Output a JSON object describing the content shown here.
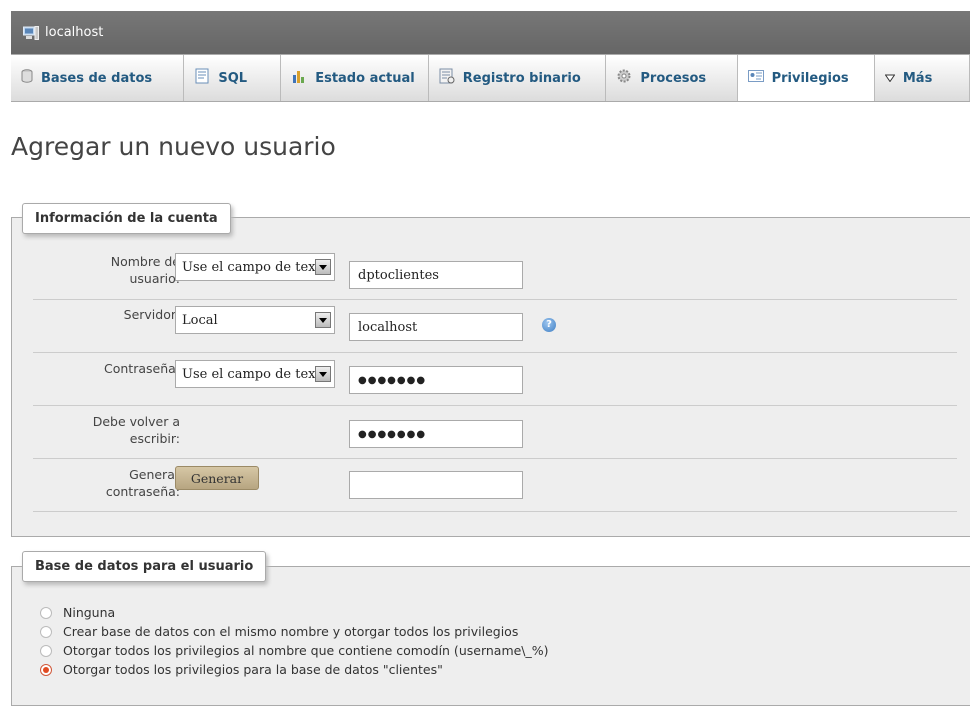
{
  "titlebar": {
    "server": "localhost",
    "icon": "server-icon"
  },
  "tabs": [
    {
      "label": "Bases de datos",
      "icon": "database-icon",
      "active": false
    },
    {
      "label": "SQL",
      "icon": "sql-icon",
      "active": false
    },
    {
      "label": "Estado actual",
      "icon": "status-icon",
      "active": false
    },
    {
      "label": "Registro binario",
      "icon": "binlog-icon",
      "active": false
    },
    {
      "label": "Procesos",
      "icon": "gear-icon",
      "active": false
    },
    {
      "label": "Privilegios",
      "icon": "privileges-icon",
      "active": true
    },
    {
      "label": "Más",
      "icon": "triangle-down-icon",
      "active": false
    }
  ],
  "page_title": "Agregar un nuevo usuario",
  "account": {
    "legend": "Información de la cuenta",
    "username_label": "Nombre de usuario:",
    "username_select": "Use el campo de texto",
    "username_value": "dptoclientes",
    "host_label": "Servidor:",
    "host_select": "Local",
    "host_value": "localhost",
    "password_label": "Contraseña:",
    "password_select": "Use el campo de texto",
    "password_mask": "●●●●●●●",
    "retype_label": "Debe volver a escribir:",
    "retype_mask": "●●●●●●●",
    "generate_label": "Generar contraseña:",
    "generate_button": "Generar",
    "generate_value": ""
  },
  "database": {
    "legend": "Base de datos para el usuario",
    "options": [
      {
        "label": "Ninguna",
        "checked": false
      },
      {
        "label": "Crear base de datos con el mismo nombre y otorgar todos los privilegios",
        "checked": false
      },
      {
        "label": "Otorgar todos los privilegios al nombre que contiene comodín (username\\_%)",
        "checked": false
      },
      {
        "label": "Otorgar todos los privilegios para la base de datos \"clientes\"",
        "checked": true
      }
    ]
  },
  "colors": {
    "tab_text": "#235a81",
    "titlebar": "#6b6b6b",
    "accent_radio": "#e14b22"
  }
}
